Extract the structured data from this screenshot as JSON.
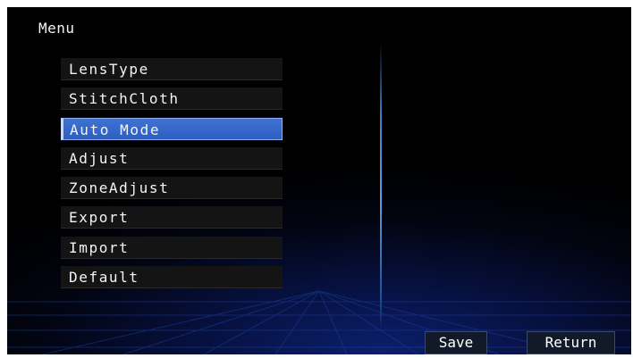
{
  "title": "Menu",
  "menu": {
    "items": [
      {
        "label": "LensType"
      },
      {
        "label": "StitchCloth"
      },
      {
        "label": "Auto Mode"
      },
      {
        "label": "Adjust"
      },
      {
        "label": "ZoneAdjust"
      },
      {
        "label": "Export"
      },
      {
        "label": "Import"
      },
      {
        "label": "Default"
      }
    ],
    "selected_label": "Auto Mode"
  },
  "buttons": {
    "save_label": "Save",
    "return_label": "Return"
  },
  "colors": {
    "background": "#000000",
    "selected": "#3468c8",
    "accent_line": "#4a90d8"
  }
}
